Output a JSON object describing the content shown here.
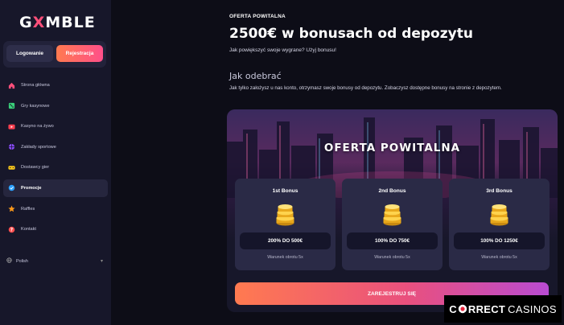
{
  "brand": {
    "logo_pre": "G",
    "logo_x": "X",
    "logo_post": "MBLE"
  },
  "auth": {
    "login_label": "Logowanie",
    "register_label": "Rejestracja"
  },
  "sidebar": {
    "items": [
      {
        "label": "Strona główna",
        "icon": "home-icon",
        "color": "#ff4f7a"
      },
      {
        "label": "Gry kasynowe",
        "icon": "dice-icon",
        "color": "#3ad17a"
      },
      {
        "label": "Kasyno na żywo",
        "icon": "live-icon",
        "color": "#ff4050"
      },
      {
        "label": "Zakłady sportowe",
        "icon": "ball-icon",
        "color": "#8a4cff"
      },
      {
        "label": "Dostawcy gier",
        "icon": "controller-icon",
        "color": "#ffcc1a"
      },
      {
        "label": "Promocje",
        "icon": "promo-icon",
        "color": "#2aa0ff",
        "active": true
      },
      {
        "label": "Raffles",
        "icon": "star-icon",
        "color": "#ff9a1a"
      },
      {
        "label": "Kontakt",
        "icon": "help-icon",
        "color": "#ff4f4f"
      }
    ],
    "language": "Polish"
  },
  "main": {
    "eyebrow": "OFERTA POWITALNA",
    "headline": "2500€ w bonusach od depozytu",
    "subtitle": "Jak powiększyć swoje wygrane? Użyj bonusu!",
    "section_title": "Jak odebrać",
    "section_text": "Jak tylko założysz u nas konto, otrzymasz swoje bonusy od depozytu. Zobaczysz dostępne bonusy na stronie z depozytem."
  },
  "promo": {
    "title": "OFERTA POWITALNA",
    "bonuses": [
      {
        "title": "1st Bonus",
        "offer": "200% DO 500€",
        "condition": "Warunek obrotu 5x"
      },
      {
        "title": "2nd Bonus",
        "offer": "100% DO 750€",
        "condition": "Warunek obrotu 5x"
      },
      {
        "title": "3rd Bonus",
        "offer": "100% DO 1250€",
        "condition": "Warunek obrotu 5x"
      }
    ],
    "cta": "ZAREJESTRUJ SIĘ"
  },
  "watermark": {
    "c1": "C",
    "mid": "RRECT",
    "casinos": "CASINOS"
  }
}
